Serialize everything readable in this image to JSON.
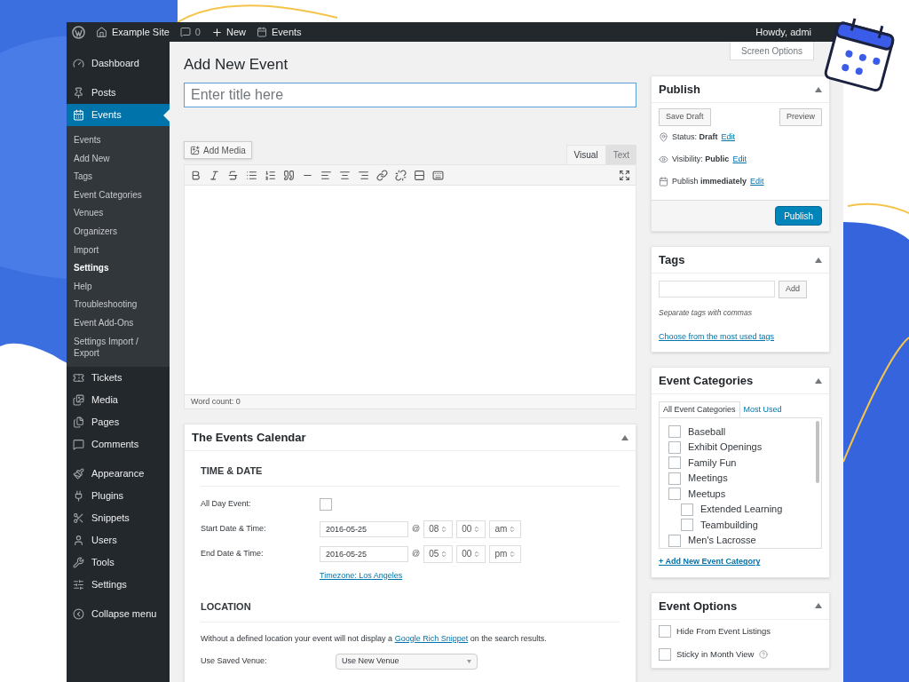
{
  "admin_bar": {
    "site": "Example Site",
    "comments": "0",
    "new": "New",
    "events": "Events",
    "greeting": "Howdy, admi"
  },
  "sidebar": {
    "groups": [
      {
        "items": [
          {
            "label": "Dashboard",
            "selected": false
          }
        ]
      },
      {
        "items": [
          {
            "label": "Posts",
            "selected": false
          },
          {
            "label": "Events",
            "selected": true,
            "children": [
              {
                "label": "Events",
                "selected": false
              },
              {
                "label": "Add New",
                "selected": false
              },
              {
                "label": "Tags",
                "selected": false
              },
              {
                "label": "Event Categories",
                "selected": false
              },
              {
                "label": "Venues",
                "selected": false
              },
              {
                "label": "Organizers",
                "selected": false
              },
              {
                "label": "Import",
                "selected": false
              },
              {
                "label": "Settings",
                "selected": true
              },
              {
                "label": "Help",
                "selected": false
              },
              {
                "label": "Troubleshooting",
                "selected": false
              },
              {
                "label": "Event Add-Ons",
                "selected": false
              },
              {
                "label": "Settings Import / Export",
                "selected": false
              }
            ]
          },
          {
            "label": "Tickets",
            "selected": false
          },
          {
            "label": "Media",
            "selected": false
          },
          {
            "label": "Pages",
            "selected": false
          },
          {
            "label": "Comments",
            "selected": false
          }
        ]
      },
      {
        "items": [
          {
            "label": "Appearance",
            "selected": false
          },
          {
            "label": "Plugins",
            "selected": false
          },
          {
            "label": "Snippets",
            "selected": false
          },
          {
            "label": "Users",
            "selected": false
          },
          {
            "label": "Tools",
            "selected": false
          },
          {
            "label": "Settings",
            "selected": false
          }
        ]
      },
      {
        "items": [
          {
            "label": "Collapse menu",
            "selected": false
          }
        ]
      }
    ]
  },
  "screen_options": "Screen Options",
  "page_title": "Add New Event",
  "title_field": {
    "placeholder": "Enter title here"
  },
  "editor": {
    "add_media": "Add Media",
    "tabs": [
      {
        "label": "Visual",
        "selected": true
      },
      {
        "label": "Text",
        "selected": false
      }
    ],
    "word_count": "Word count: 0"
  },
  "events_calendar": {
    "title": "The Events Calendar",
    "time_heading": "TIME & DATE",
    "all_day": {
      "label": "All Day Event:",
      "checked": false
    },
    "rows": [
      {
        "label": "Start Date & Time:",
        "date": "2016-05-25",
        "at": "@",
        "hour": "08",
        "minute": "00",
        "meridian": "am"
      },
      {
        "label": "End Date & Time:",
        "date": "2016-05-25",
        "at": "@",
        "hour": "05",
        "minute": "00",
        "meridian": "pm"
      }
    ],
    "timezone": "Timezone: Los Angeles",
    "location_heading": "LOCATION",
    "notice": {
      "before": "Without a defined location your event will not display a ",
      "link": "Google Rich Snippet",
      "after": " on the search results."
    },
    "venue": {
      "label": "Use Saved Venue:",
      "value": "Use New Venue"
    }
  },
  "publish": {
    "title": "Publish",
    "save_draft": "Save Draft",
    "preview": "Preview",
    "settings": [
      {
        "text": "Status: **Draft**",
        "edit": "Edit"
      },
      {
        "text": "Visibility: **Public**",
        "edit": "Edit"
      },
      {
        "text": "Publish **immediately**",
        "edit": "Edit"
      }
    ],
    "button": "Publish"
  },
  "tags": {
    "title": "Tags",
    "add": "Add",
    "hint": "Separate tags with commas",
    "link": "Choose from the most used tags"
  },
  "event_categories": {
    "title": "Event Categories",
    "tabs": [
      {
        "label": "All Event Categories",
        "selected": true
      },
      {
        "label": "Most Used",
        "selected": false
      }
    ],
    "items": [
      {
        "label": "Baseball",
        "checked": false
      },
      {
        "label": "Exhibit Openings",
        "checked": false
      },
      {
        "label": "Family Fun",
        "checked": false
      },
      {
        "label": "Meetings",
        "checked": false
      },
      {
        "label": "Meetups",
        "checked": false,
        "children": [
          {
            "label": "Extended Learning",
            "checked": false
          },
          {
            "label": "Teambuilding",
            "checked": false
          }
        ]
      },
      {
        "label": "Men's Lacrosse",
        "checked": false
      }
    ],
    "add_link": "+ Add New Event Category"
  },
  "event_options": {
    "title": "Event Options",
    "items": [
      {
        "label": "Hide From Event Listings",
        "checked": false,
        "help": false
      },
      {
        "label": "Sticky in Month View",
        "checked": false,
        "help": true
      }
    ]
  }
}
